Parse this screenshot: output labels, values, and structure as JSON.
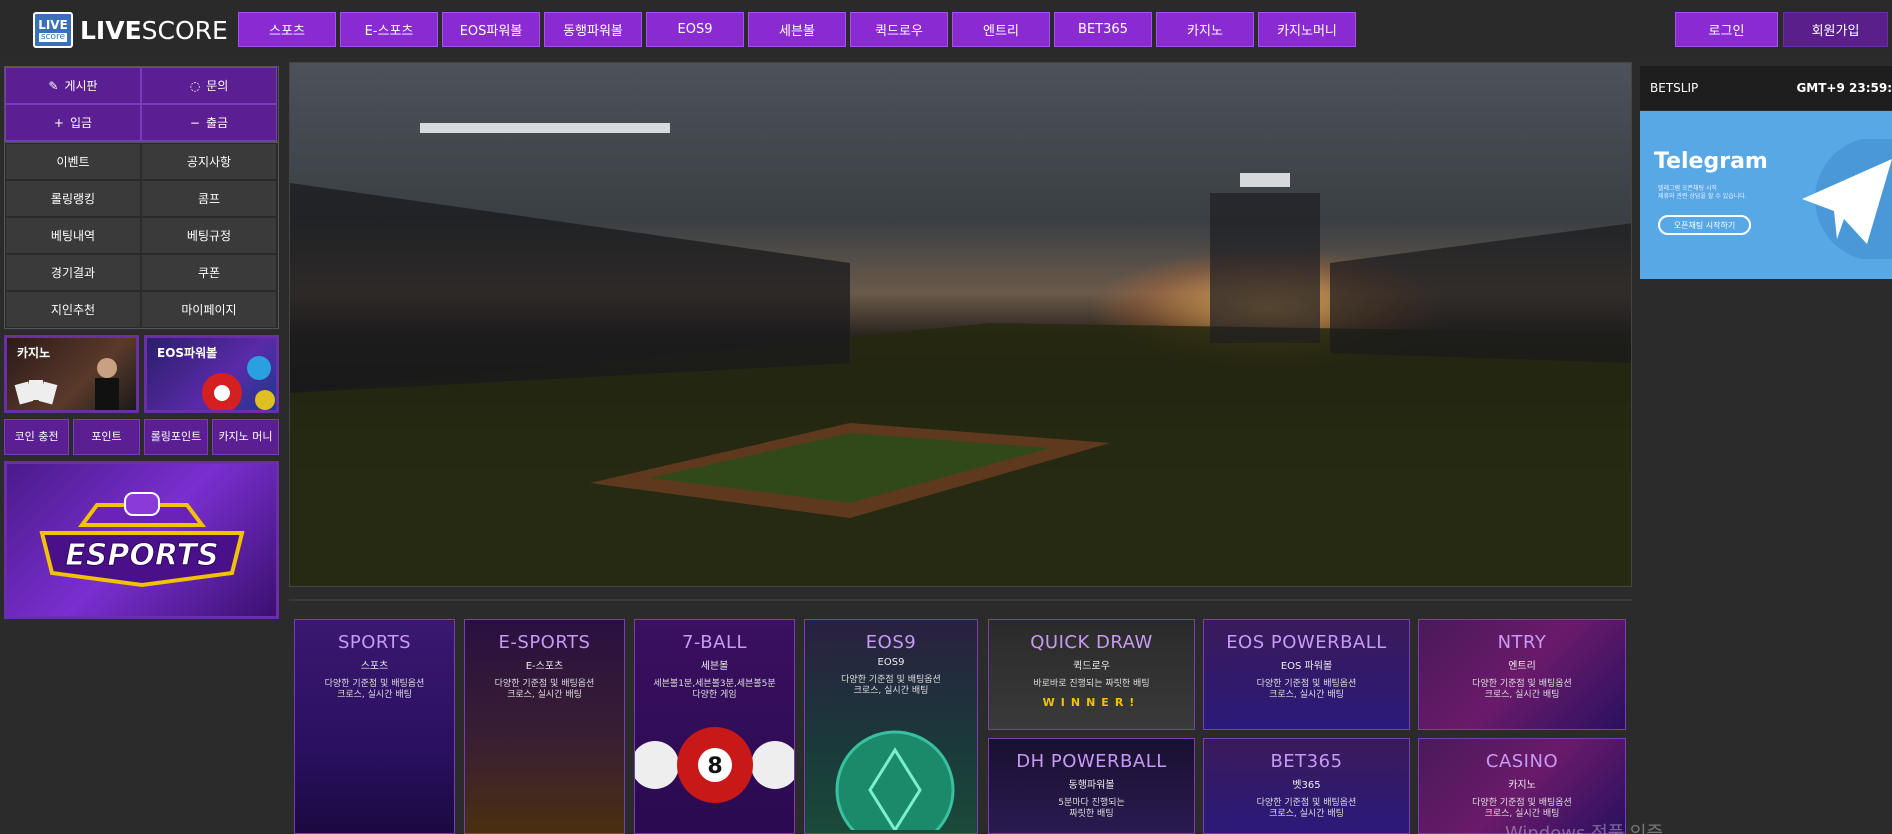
{
  "brand": {
    "logo_top": "LIVE",
    "logo_bottom": "score",
    "name_bold": "LIVE",
    "name_light": "SCORE"
  },
  "topnav": [
    "스포츠",
    "E-스포츠",
    "EOS파워볼",
    "동행파워볼",
    "EOS9",
    "세븐볼",
    "퀵드로우",
    "엔트리",
    "BET365",
    "카지노",
    "카지노머니"
  ],
  "auth": {
    "login": "로그인",
    "signup": "회원가입"
  },
  "sidebar": {
    "primary": [
      {
        "label": "게시판",
        "icon": "edit-icon"
      },
      {
        "label": "문의",
        "icon": "chat-icon"
      },
      {
        "label": "입금",
        "icon": "plus-icon"
      },
      {
        "label": "출금",
        "icon": "minus-icon"
      }
    ],
    "secondary": [
      "이벤트",
      "공지사항",
      "롤링랭킹",
      "콤프",
      "베팅내역",
      "베팅규정",
      "경기결과",
      "쿠폰",
      "지인추천",
      "마이페이지"
    ],
    "promos": [
      "카지노",
      "EOS파워볼"
    ],
    "small": [
      "코인 충전",
      "포인트",
      "롤링포인트",
      "카지노 머니"
    ],
    "esports_banner": "ESPORTS"
  },
  "games": [
    {
      "title": "SPORTS",
      "sub": "스포츠",
      "desc": "다양한 기준점 및 배팅옵션\n크로스, 실시간 배팅"
    },
    {
      "title": "E-SPORTS",
      "sub": "E-스포츠",
      "desc": "다양한 기준점 및 배팅옵션\n크로스, 실시간 배팅"
    },
    {
      "title": "7-BALL",
      "sub": "세븐볼",
      "desc": "세븐볼1분,세븐볼3분,세븐볼5분\n다양한 게임"
    },
    {
      "title": "EOS9",
      "sub": "EOS9",
      "desc": "다양한 기준점 및 배팅옵션\n크로스, 실시간 배팅"
    },
    {
      "title": "QUICK DRAW",
      "sub": "퀵드로우",
      "desc": "바로바로 진행되는 짜릿한 배팅",
      "extra": "WINNER!"
    },
    {
      "title": "EOS POWERBALL",
      "sub": "EOS 파워볼",
      "desc": "다양한 기준점 및 배팅옵션\n크로스, 실시간 배팅"
    },
    {
      "title": "NTRY",
      "sub": "엔트리",
      "desc": "다양한 기준점 및 배팅옵션\n크로스, 실시간 배팅"
    },
    {
      "title": "DH POWERBALL",
      "sub": "동행파워볼",
      "desc": "5분마다 진행되는\n짜릿한 배팅"
    },
    {
      "title": "BET365",
      "sub": "벳365",
      "desc": "다양한 기준점 및 배팅옵션\n크로스, 실시간 배팅"
    },
    {
      "title": "CASINO",
      "sub": "카지노",
      "desc": "다양한 기준점 및 배팅옵션\n크로스, 실시간 배팅"
    }
  ],
  "betslip": {
    "label": "BETSLIP",
    "time": "GMT+9 23:59:"
  },
  "telegram": {
    "title": "Telegram",
    "text": "텔레그램 오픈채팅 시작\n제휴와 관련 상담을 할 수 있습니다.",
    "button": "오픈채팅 시작하기"
  },
  "watermark": "Windows 정품 인증",
  "colors": {
    "accent": "#8a2ad1",
    "telegram": "#58a8e6",
    "card_title": "#c89af5"
  }
}
